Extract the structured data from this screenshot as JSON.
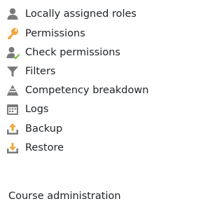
{
  "menu": {
    "items": [
      {
        "label": "Locally assigned roles",
        "icon": "user-icon"
      },
      {
        "label": "Permissions",
        "icon": "key-icon"
      },
      {
        "label": "Check permissions",
        "icon": "user-check-icon"
      },
      {
        "label": "Filters",
        "icon": "filter-icon"
      },
      {
        "label": "Competency breakdown",
        "icon": "triangle-icon"
      },
      {
        "label": "Logs",
        "icon": "calendar-icon"
      },
      {
        "label": "Backup",
        "icon": "upload-icon"
      },
      {
        "label": "Restore",
        "icon": "download-icon"
      }
    ],
    "section_title": "Course administration"
  },
  "colors": {
    "text": "#1d2125",
    "icon": "#7a7a7a",
    "icon_accent": "#f0a73a",
    "icon_badge": "#7ab94b"
  }
}
